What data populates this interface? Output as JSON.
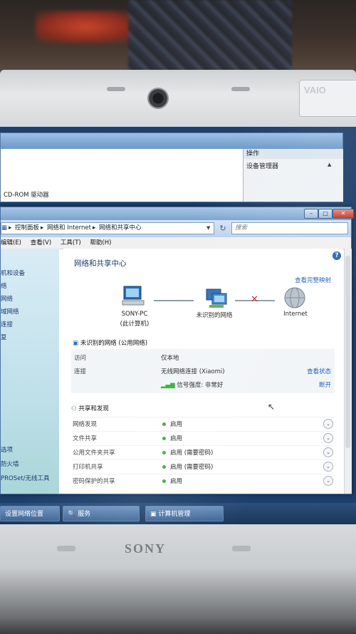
{
  "device": {
    "bezel_brand": "SONY",
    "lid_badge": "VAIO"
  },
  "back_window": {
    "row_text": "CD-ROM 驱动器",
    "ops_header": "操作",
    "ops_item": "设备管理器"
  },
  "window": {
    "address_parts": [
      "控制面板",
      "网络和 Internet",
      "网络和共享中心"
    ],
    "search_placeholder": "搜索",
    "menu": [
      "编辑(E)",
      "查看(V)",
      "工具(T)",
      "帮助(H)"
    ],
    "sidebar_items": [
      "机和设备",
      "络",
      "网络",
      "域网络",
      "连接",
      "复"
    ],
    "sidebar_bottom_items": [
      "选项",
      "防火墙",
      "PROSet/无线工具"
    ],
    "content_title": "网络和共享中心",
    "view_full_map": "查看完整映射",
    "map": {
      "node1_line1": "SONY-PC",
      "node1_line2": "(此计算机)",
      "node2": "未识别的网络",
      "node3": "Internet"
    },
    "network": {
      "header": "未识别的网络 (公用网络)",
      "access_label": "访问",
      "access_value": "仅本地",
      "conn_label": "连接",
      "conn_value": "无线网络连接 (Xiaomi)",
      "view_status": "查看状态",
      "signal": "信号强度: 非常好",
      "disconnect": "断开"
    },
    "sharing": {
      "header": "共享和发现",
      "rows": [
        {
          "label": "网络发现",
          "value": "启用"
        },
        {
          "label": "文件共享",
          "value": "启用"
        },
        {
          "label": "公用文件夹共享",
          "value": "启用 (需要密码)"
        },
        {
          "label": "打印机共享",
          "value": "启用 (需要密码)"
        },
        {
          "label": "密码保护的共享",
          "value": "启用"
        }
      ]
    }
  },
  "taskbar": {
    "items": [
      "设置网络位置",
      "服务",
      "计算机管理"
    ]
  }
}
